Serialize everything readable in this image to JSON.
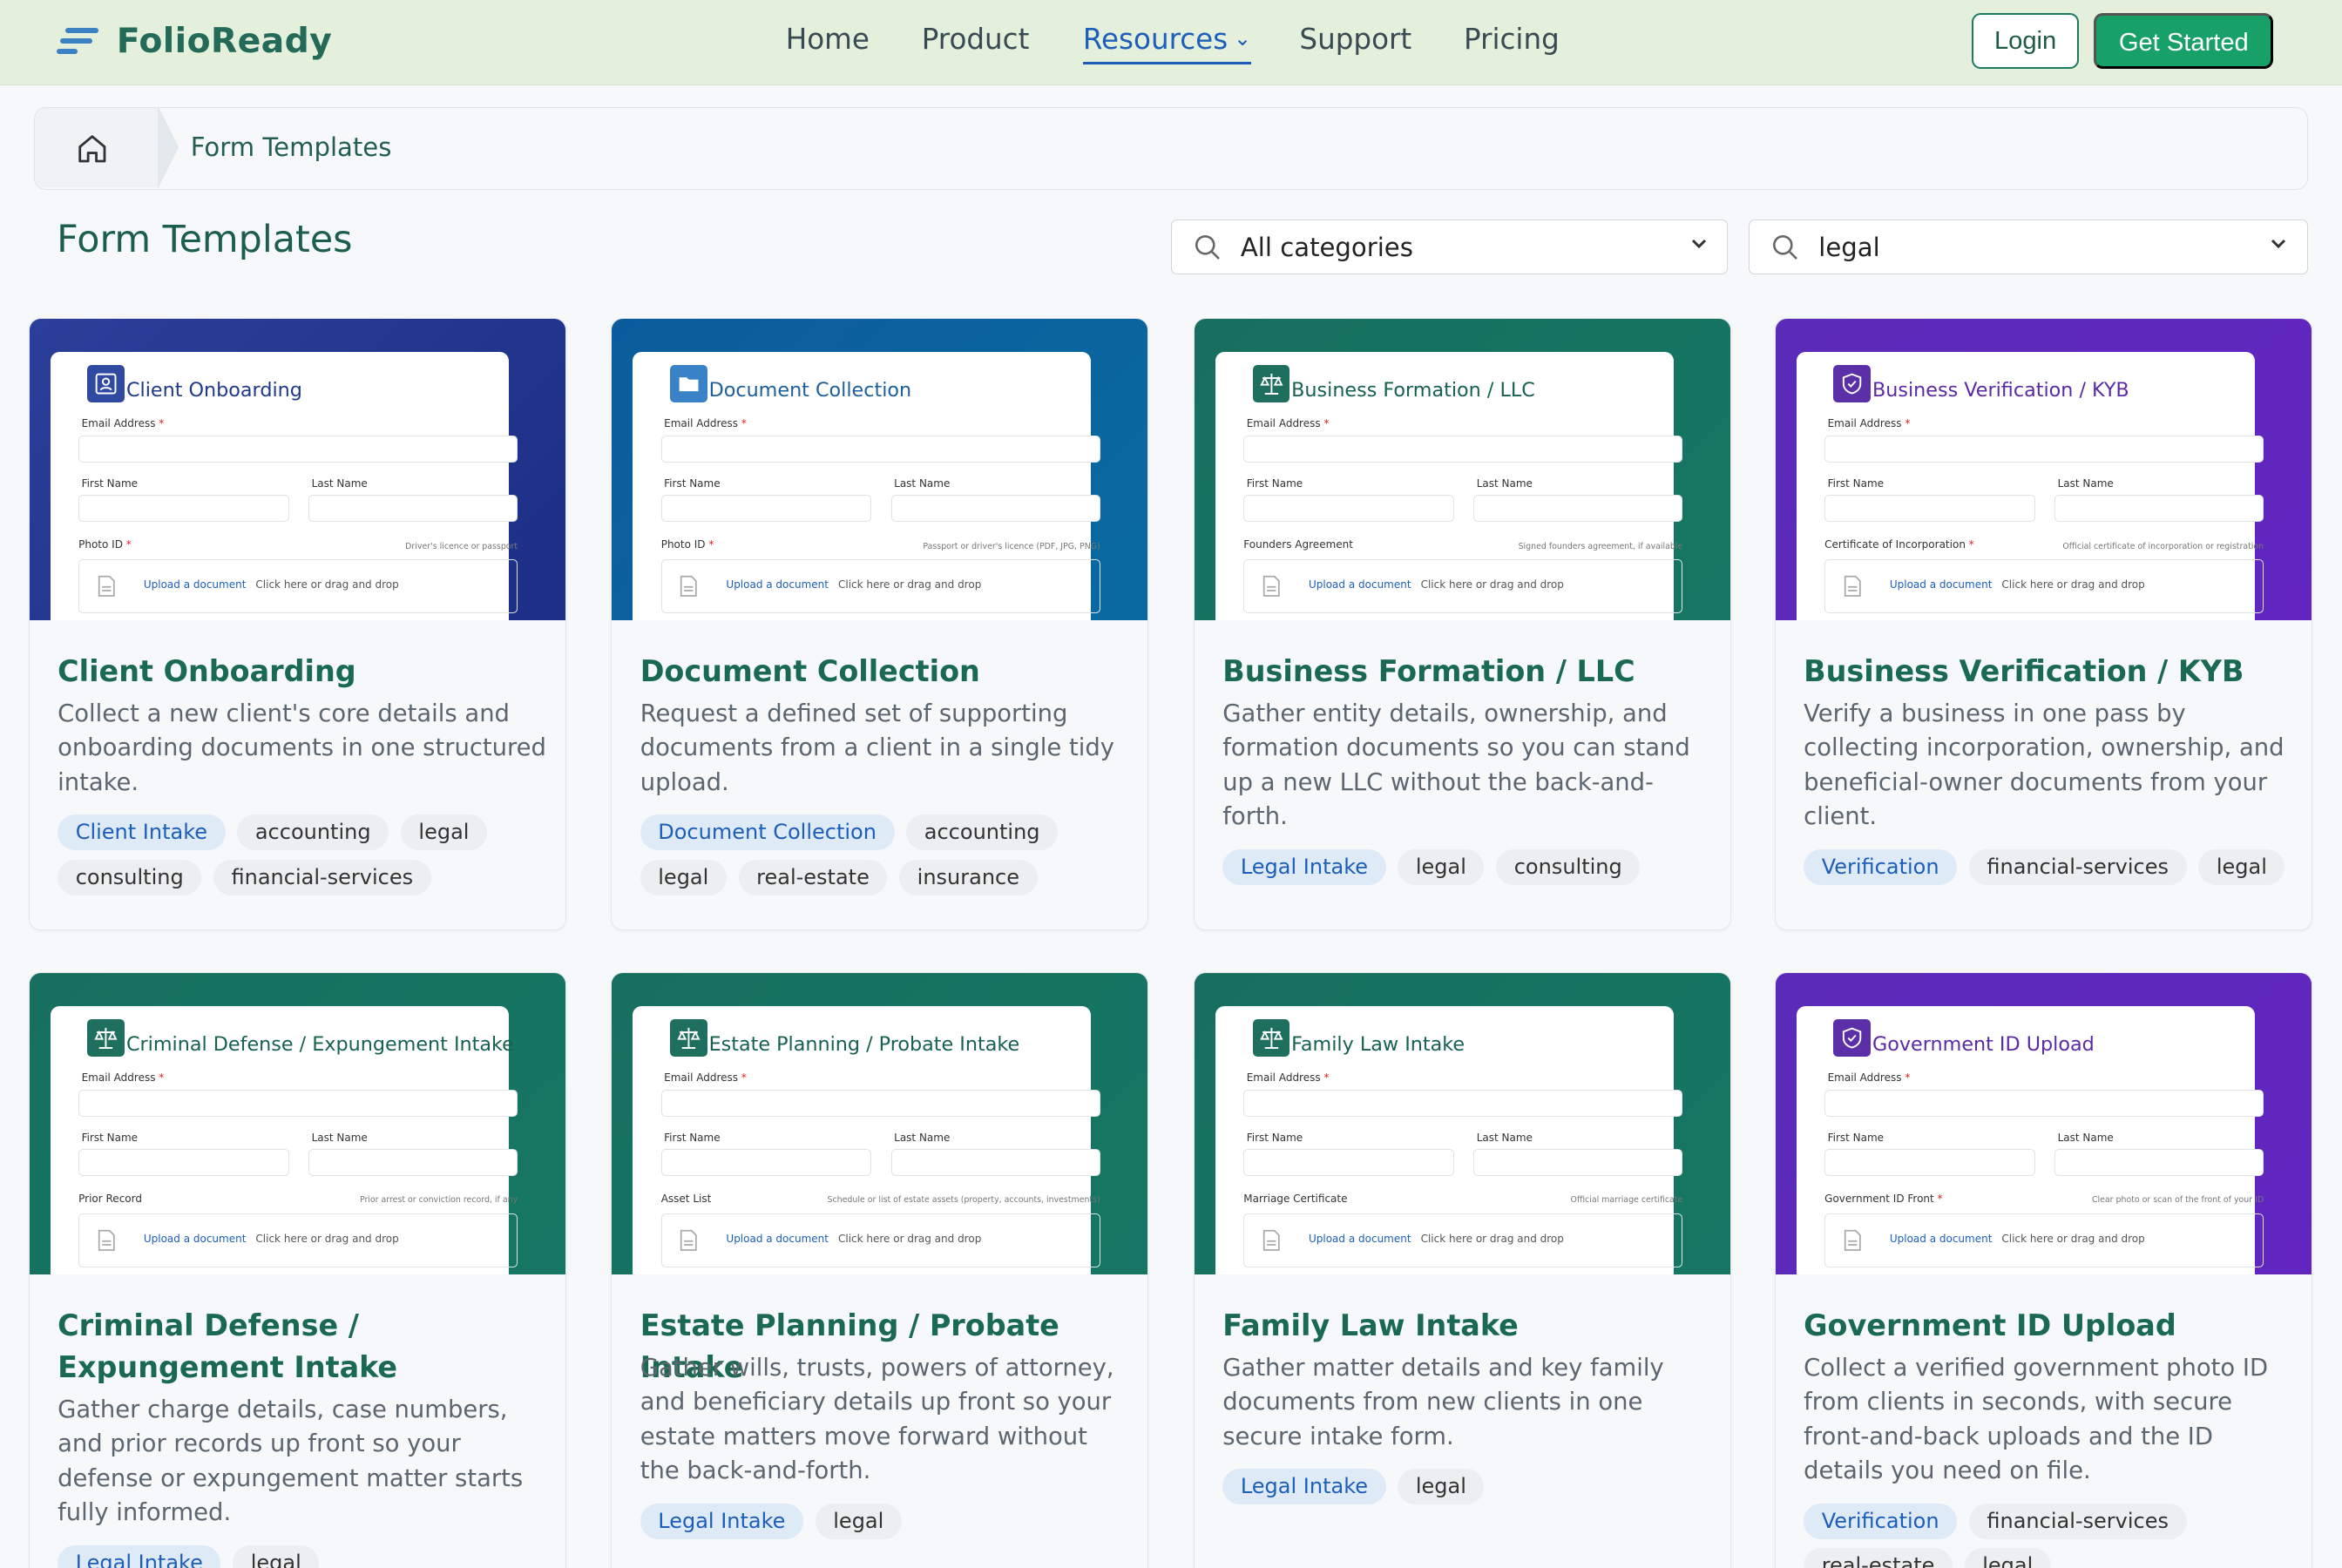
{
  "brand": {
    "name": "FolioReady",
    "accent": "#17a068",
    "logo_color": "#3b82c4"
  },
  "nav": {
    "links": [
      {
        "label": "Home"
      },
      {
        "label": "Product"
      },
      {
        "label": "Resources",
        "active": true
      },
      {
        "label": "Support"
      },
      {
        "label": "Pricing"
      }
    ],
    "login_label": "Login",
    "cta_label": "Get Started"
  },
  "breadcrumb": {
    "home_icon": "home-icon",
    "current": "Form Templates"
  },
  "page_title": "Form Templates",
  "filters": {
    "category": {
      "value": "All categories",
      "icon": "search-icon"
    },
    "search": {
      "value": "legal",
      "icon": "search-icon"
    }
  },
  "preview_common": {
    "email_label": "Email Address",
    "first_name_label": "First Name",
    "last_name_label": "Last Name",
    "upload_link": "Upload a document",
    "upload_hint": "Click here or drag and drop"
  },
  "cards": [
    {
      "banner_from": "#2b3f9a",
      "banner_to": "#1c2e85",
      "icon_bg": "#2f4aa0",
      "title_color": "#1f3a8a",
      "icon": "id-card-icon",
      "preview_title": "Client Onboarding",
      "doc_label": "Photo ID",
      "doc_required": true,
      "doc_hint": "Driver's licence or passport",
      "title": "Client Onboarding",
      "description": "Collect a new client's core details and onboarding documents in one structured intake.",
      "tags": [
        "Client Intake",
        "accounting",
        "legal",
        "consulting",
        "financial-services"
      ]
    },
    {
      "banner_from": "#0b5c9c",
      "banner_to": "#0a6aa0",
      "icon_bg": "#3a82c8",
      "title_color": "#1d5f9a",
      "icon": "folder-icon",
      "preview_title": "Document Collection",
      "doc_label": "Photo ID",
      "doc_required": true,
      "doc_hint": "Passport or driver's licence (PDF, JPG, PNG)",
      "title": "Document Collection",
      "description": "Request a defined set of supporting documents from a client in a single tidy upload.",
      "tags": [
        "Document Collection",
        "accounting",
        "legal",
        "real-estate",
        "insurance"
      ]
    },
    {
      "banner_from": "#17705f",
      "banner_to": "#157763",
      "icon_bg": "#1f6f5e",
      "title_color": "#16624f",
      "icon": "scales-icon",
      "preview_title": "Business Formation / LLC",
      "doc_label": "Founders Agreement",
      "doc_required": false,
      "doc_hint": "Signed founders agreement, if available",
      "title": "Business Formation / LLC",
      "description": "Gather entity details, ownership, and formation documents so you can stand up a new LLC without the back-and-forth.",
      "tags": [
        "Legal Intake",
        "legal",
        "consulting"
      ]
    },
    {
      "banner_from": "#5a2bb8",
      "banner_to": "#6225c0",
      "icon_bg": "#5b2fa8",
      "title_color": "#5a2aa6",
      "icon": "shield-icon",
      "preview_title": "Business Verification / KYB",
      "doc_label": "Certificate of Incorporation",
      "doc_required": true,
      "doc_hint": "Official certificate of incorporation or registration",
      "title": "Business Verification / KYB",
      "description": "Verify a business in one pass by collecting incorporation, ownership, and beneficial-owner documents from your client.",
      "tags": [
        "Verification",
        "financial-services",
        "legal"
      ]
    },
    {
      "banner_from": "#17705f",
      "banner_to": "#157763",
      "icon_bg": "#1f6f5e",
      "title_color": "#16624f",
      "icon": "scales-icon",
      "preview_title": "Criminal Defense / Expungement Intake",
      "doc_label": "Prior Record",
      "doc_required": false,
      "doc_hint": "Prior arrest or conviction record, if any",
      "title": "Criminal Defense / Expungement Intake",
      "description": "Gather charge details, case numbers, and prior records up front so your defense or expungement matter starts fully informed.",
      "tags": [
        "Legal Intake",
        "legal"
      ]
    },
    {
      "banner_from": "#17705f",
      "banner_to": "#157763",
      "icon_bg": "#1f6f5e",
      "title_color": "#16624f",
      "icon": "scales-icon",
      "preview_title": "Estate Planning / Probate Intake",
      "doc_label": "Asset List",
      "doc_required": false,
      "doc_hint": "Schedule or list of estate assets (property, accounts, investments)",
      "title": "Estate Planning / Probate Intake",
      "description": "Gather wills, trusts, powers of attorney, and beneficiary details up front so your estate matters move forward without the back-and-forth.",
      "tags": [
        "Legal Intake",
        "legal"
      ]
    },
    {
      "banner_from": "#17705f",
      "banner_to": "#157763",
      "icon_bg": "#1f6f5e",
      "title_color": "#16624f",
      "icon": "scales-icon",
      "preview_title": "Family Law Intake",
      "doc_label": "Marriage Certificate",
      "doc_required": false,
      "doc_hint": "Official marriage certificate",
      "title": "Family Law Intake",
      "description": "Gather matter details and key family documents from new clients in one secure intake form.",
      "tags": [
        "Legal Intake",
        "legal"
      ]
    },
    {
      "banner_from": "#5a2bb8",
      "banner_to": "#6225c0",
      "icon_bg": "#5b2fa8",
      "title_color": "#5a2aa6",
      "icon": "shield-icon",
      "preview_title": "Government ID Upload",
      "doc_label": "Government ID Front",
      "doc_required": true,
      "doc_hint": "Clear photo or scan of the front of your ID",
      "title": "Government ID Upload",
      "description": "Collect a verified government photo ID from clients in seconds, with secure front-and-back uploads and the ID details you need on file.",
      "tags": [
        "Verification",
        "financial-services",
        "real-estate",
        "legal"
      ]
    }
  ]
}
